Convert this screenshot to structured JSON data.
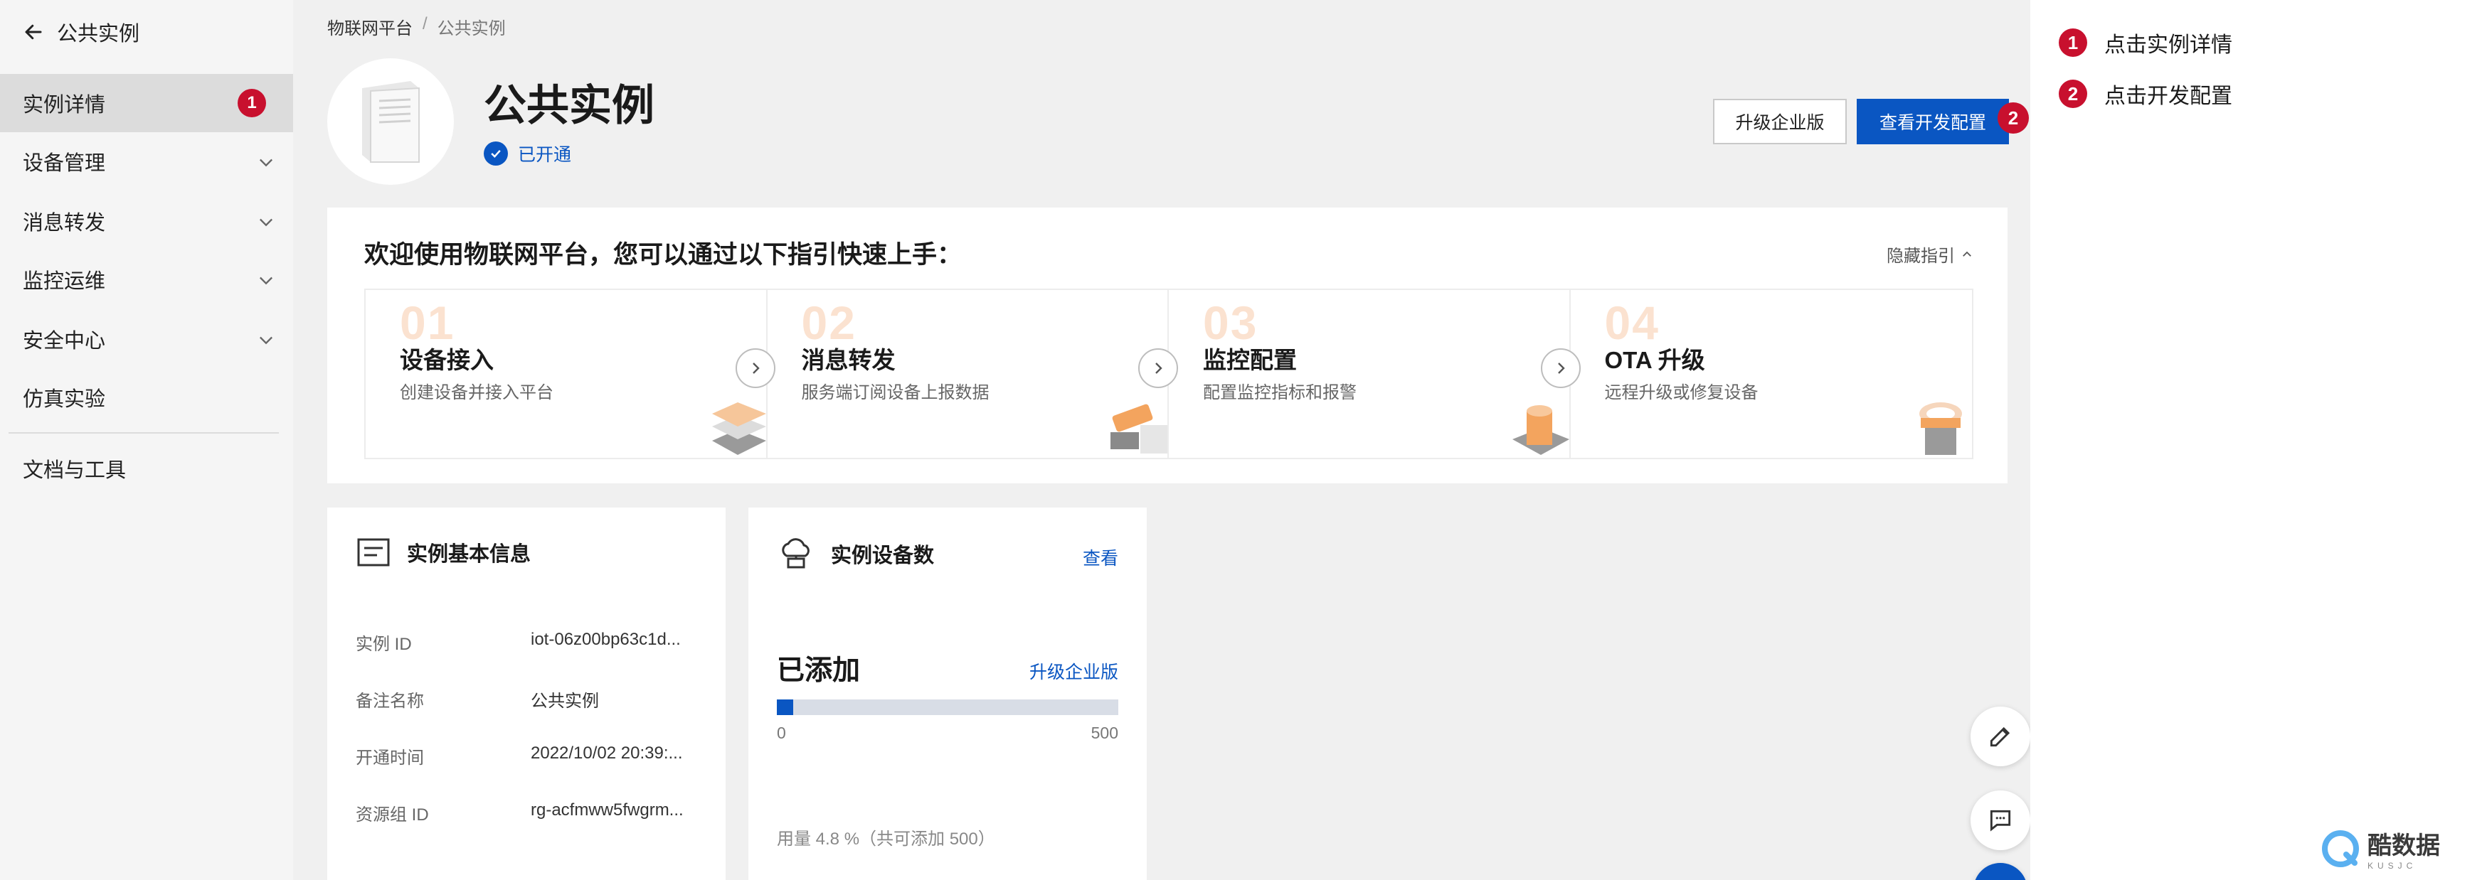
{
  "sidebar": {
    "back_title": "公共实例",
    "items": [
      {
        "label": "实例详情",
        "active": true,
        "badge": "1"
      },
      {
        "label": "设备管理",
        "expandable": true
      },
      {
        "label": "消息转发",
        "expandable": true
      },
      {
        "label": "监控运维",
        "expandable": true
      },
      {
        "label": "安全中心",
        "expandable": true
      },
      {
        "label": "仿真实验"
      }
    ],
    "docs_label": "文档与工具"
  },
  "breadcrumb": {
    "root": "物联网平台",
    "separator": "/",
    "current": "公共实例"
  },
  "header": {
    "title": "公共实例",
    "status": "已开通",
    "upgrade_button": "升级企业版",
    "dev_config_button": "查看开发配置",
    "dev_config_badge": "2"
  },
  "guide": {
    "title": "欢迎使用物联网平台，您可以通过以下指引快速上手：",
    "hide_label": "隐藏指引",
    "steps": [
      {
        "num": "01",
        "title": "设备接入",
        "desc": "创建设备并接入平台"
      },
      {
        "num": "02",
        "title": "消息转发",
        "desc": "服务端订阅设备上报数据"
      },
      {
        "num": "03",
        "title": "监控配置",
        "desc": "配置监控指标和报警"
      },
      {
        "num": "04",
        "title": "OTA 升级",
        "desc": "远程升级或修复设备"
      }
    ]
  },
  "basic_info": {
    "title": "实例基本信息",
    "rows": [
      {
        "label": "实例 ID",
        "value": "iot-06z00bp63c1d..."
      },
      {
        "label": "备注名称",
        "value": "公共实例"
      },
      {
        "label": "开通时间",
        "value": "2022/10/02 20:39:..."
      },
      {
        "label": "资源组 ID",
        "value": "rg-acfmww5fwgrm..."
      }
    ]
  },
  "device_count": {
    "title": "实例设备数",
    "view_link": "查看",
    "added_label": "已添加",
    "upgrade_link": "升级企业版",
    "progress_fraction": 0.048,
    "min": "0",
    "max": "500",
    "usage_text": "用量 4.8 %（共可添加 500）"
  },
  "annotations": [
    {
      "badge": "1",
      "text": "点击实例详情"
    },
    {
      "badge": "2",
      "text": "点击开发配置"
    }
  ],
  "watermark": {
    "text": "酷数据",
    "sub": "KUSJC"
  },
  "colors": {
    "accent": "#0a56c2",
    "badge": "#c8102e",
    "step_number": "#fbe2d0"
  },
  "icons": [
    "back-arrow-icon",
    "chevron-down-icon",
    "collapse-left-icon",
    "server-icon",
    "check-icon",
    "chevron-up-icon",
    "arrow-right-icon",
    "info-card-icon",
    "cloud-device-icon",
    "edit-icon",
    "chat-icon"
  ]
}
